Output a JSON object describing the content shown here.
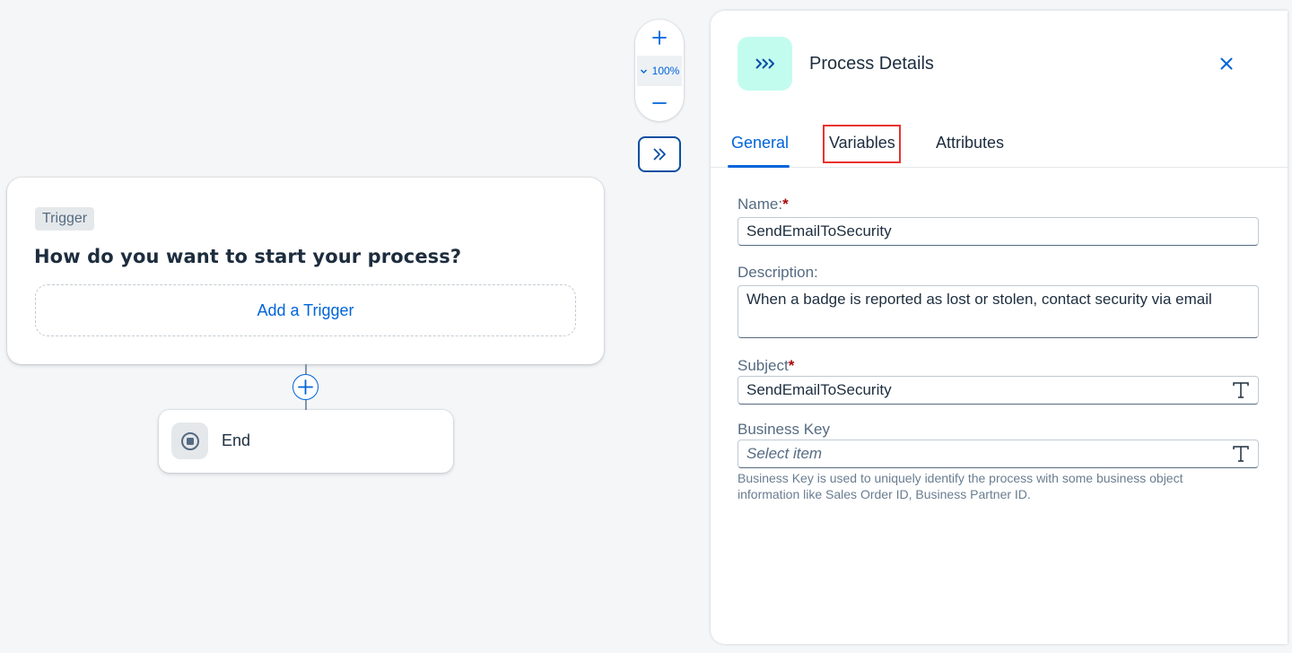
{
  "canvas": {
    "trigger": {
      "tag": "Trigger",
      "question": "How do you want to start your process?",
      "add_label": "Add a Trigger"
    },
    "end": {
      "label": "End",
      "icon": "stop-circle-icon"
    }
  },
  "zoom": {
    "level": "100%",
    "plus_icon": "plus-icon",
    "minus_icon": "minus-icon"
  },
  "panel": {
    "title": "Process Details",
    "icon": "process-chevrons-icon",
    "tabs": [
      {
        "label": "General",
        "active": true
      },
      {
        "label": "Variables",
        "highlighted": true
      },
      {
        "label": "Attributes"
      }
    ],
    "fields": {
      "name": {
        "label": "Name:",
        "required_mark": "*",
        "value": "SendEmailToSecurity"
      },
      "description": {
        "label": "Description:",
        "value": "When a badge is reported as lost or stolen, contact security via email"
      },
      "subject": {
        "label": "Subject",
        "required_mark": "*",
        "value": "SendEmailToSecurity"
      },
      "business_key": {
        "label": "Business Key",
        "placeholder": "Select item",
        "help": "Business Key is used to uniquely identify the process with some business object information like Sales Order ID, Business Partner ID."
      }
    }
  },
  "colors": {
    "accent": "#0064d9",
    "highlight_border": "#e8332f",
    "panel_icon_bg": "#c2fcee",
    "required": "#aa0808"
  }
}
